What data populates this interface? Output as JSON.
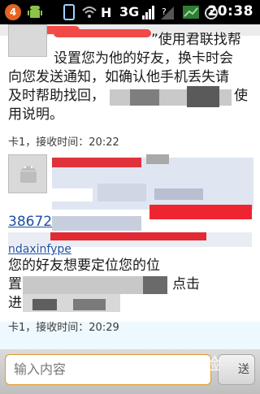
{
  "status_bar": {
    "notification_count": "4",
    "network_label": "3G",
    "time": "20:38"
  },
  "conversation": {
    "message1": {
      "text_line_1_suffix": "”使用君联找帮",
      "text_line_2": "设置您为他的好友，换卡时会",
      "text_line_3": "向您发送通知，如确认他手机丢失请",
      "text_line_4_prefix": "及时帮助找回，",
      "text_line_4_suffix": "使",
      "text_line_5": "用说明。",
      "meta": "卡1，接收时间：20:22"
    },
    "message2": {
      "number_prefix": "38672",
      "link_fragment": "ndaxinfype",
      "text_line_1": "您的好友想要定位您的位",
      "text_line_2_prefix": "置",
      "text_line_2_suffix": "点击",
      "text_line_3_prefix": "进",
      "meta": "卡1，接收时间：20:29"
    }
  },
  "composer": {
    "placeholder": "输入内容",
    "send_label": "送"
  },
  "watermark": "Bai经验"
}
